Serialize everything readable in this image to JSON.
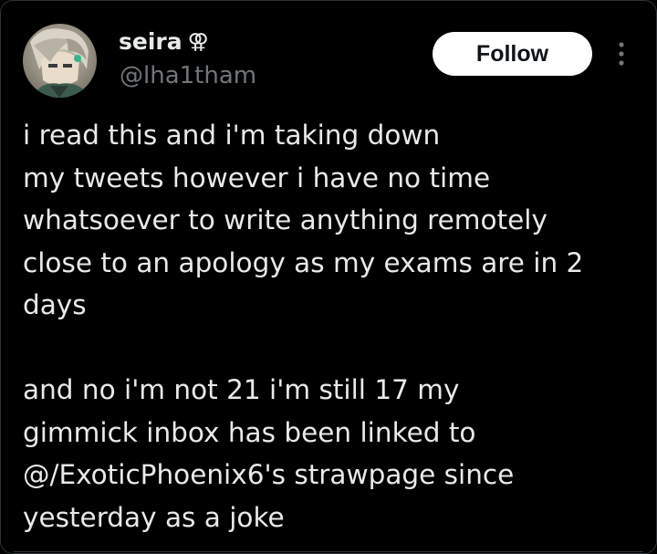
{
  "author": {
    "display_name": "seira",
    "name_symbol": "⚢",
    "handle": "@lha1tham",
    "avatar_icon": "avatar-portrait"
  },
  "actions": {
    "follow_label": "Follow",
    "more_icon": "more-vertical-icon"
  },
  "tweet": {
    "paragraph1": [
      "i read this and i'm taking down",
      "my tweets however i have no time",
      "whatsoever to write anything remotely",
      "close to an apology as my exams are in 2",
      "days"
    ],
    "paragraph2": [
      "and no i'm not 21 i'm still 17 my",
      "gimmick inbox has been linked to",
      "@/ExoticPhoenix6's strawpage since",
      "yesterday as a joke"
    ]
  },
  "colors": {
    "background": "#000000",
    "text": "#e7e9ea",
    "secondary_text": "#71767b",
    "follow_bg": "#ffffff",
    "follow_text": "#0f1419",
    "border": "#2f3336"
  }
}
